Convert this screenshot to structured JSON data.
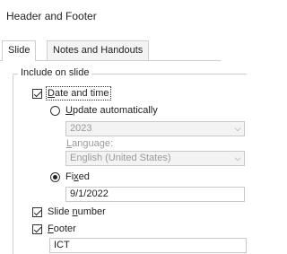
{
  "dialog": {
    "title": "Header and Footer"
  },
  "tabs": [
    {
      "label": "Slide",
      "active": true
    },
    {
      "label": "Notes and Handouts",
      "active": false
    }
  ],
  "group": {
    "legend": "Include on slide"
  },
  "options": {
    "date_time": {
      "label_pre": "",
      "label_u": "D",
      "label_post": "ate and time",
      "checked": true
    },
    "update_auto": {
      "label_u": "U",
      "label_post": "pdate automatically",
      "selected": false
    },
    "date_format": {
      "value": "2023"
    },
    "language": {
      "label_u": "L",
      "label_post": "anguage:",
      "value": "English (United States)"
    },
    "fixed": {
      "label_pre": "Fi",
      "label_u": "x",
      "label_post": "ed",
      "selected": true,
      "value": "9/1/2022"
    },
    "slide_number": {
      "label_pre": "Slide ",
      "label_u": "n",
      "label_post": "umber",
      "checked": true
    },
    "footer": {
      "label_u": "F",
      "label_post": "ooter",
      "checked": true,
      "value": "ICT"
    }
  },
  "icons": {
    "dropdown": "chevron-down-icon",
    "check": "check-icon"
  }
}
